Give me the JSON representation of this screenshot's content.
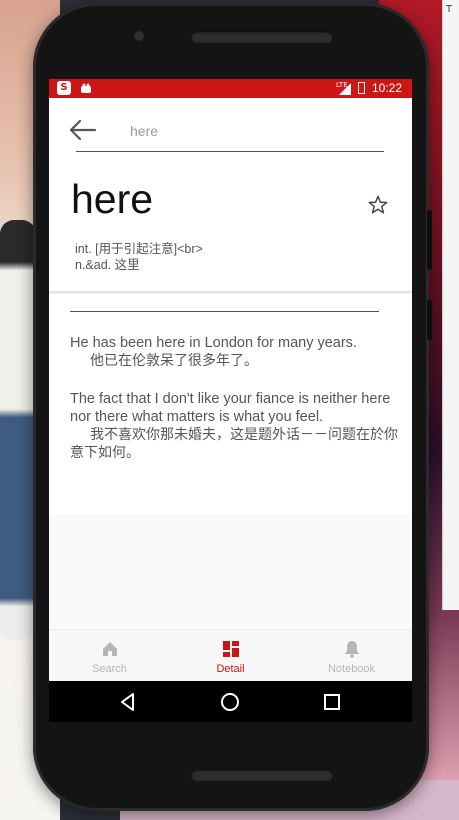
{
  "status_bar": {
    "time": "10:22",
    "network": "LTE",
    "app_icons": [
      "sogou-icon",
      "android-debug-icon"
    ]
  },
  "search": {
    "query": "here",
    "placeholder": ""
  },
  "entry": {
    "headword": "here",
    "definition": "int. [用于引起注意]<br>\nn.&ad. 这里"
  },
  "examples": [
    {
      "en": "He has been here in London for many years.",
      "cn": "他已在伦敦呆了很多年了。"
    },
    {
      "en": " The fact that I don't like your fiance is neither here nor there what matters is what you feel.",
      "cn": "我不喜欢你那未婚夫，这是题外话－－问题在於你意下如何。"
    }
  ],
  "bottom_nav": [
    {
      "label": "Search",
      "icon": "home-icon",
      "active": false
    },
    {
      "label": "Detail",
      "icon": "detail-grid-icon",
      "active": true
    },
    {
      "label": "Notebook",
      "icon": "bell-icon",
      "active": false
    }
  ],
  "colors": {
    "accent": "#cc1616",
    "inactive": "#b5b5b5",
    "text": "#555555",
    "headword": "#111111"
  },
  "editor_gutter_mark": "T"
}
